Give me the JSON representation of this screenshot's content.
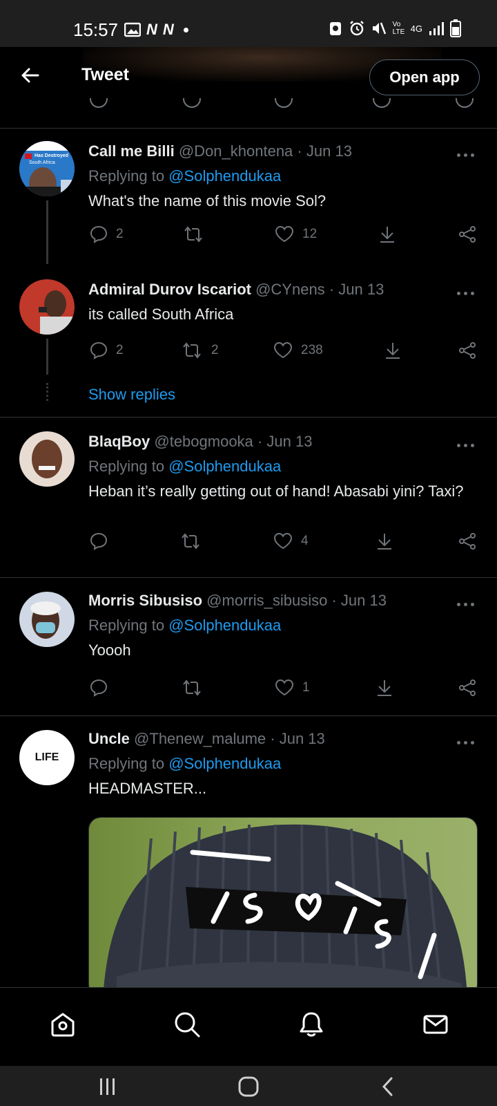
{
  "status_bar": {
    "time": "15:57",
    "network": "4G",
    "volte": "Vo LTE"
  },
  "header": {
    "title": "Tweet",
    "open_app_label": "Open app"
  },
  "tweets": [
    {
      "name": "Call me Billi",
      "handle": "@Don_khontena",
      "date": "Jun 13",
      "replying_label": "Replying to",
      "replying_to": "@Solphendukaa",
      "text": "What's the name of this movie Sol?",
      "replies": "2",
      "retweets": "",
      "likes": "12",
      "avatar_text_top": "Has Destroyed",
      "avatar_text_mid": "South Africa"
    },
    {
      "name": "Admiral Durov Iscariot",
      "handle": "@CYnens",
      "date": "Jun 13",
      "text": "its called South Africa",
      "replies": "2",
      "retweets": "2",
      "likes": "238",
      "show_replies": "Show replies"
    },
    {
      "name": "BlaqBoy",
      "handle": "@tebogmooka",
      "date": "Jun 13",
      "replying_label": "Replying to",
      "replying_to": "@Solphendukaa",
      "text": "Heban it’s really getting out of hand! Abasabi yini? Taxi?",
      "replies": "",
      "retweets": "",
      "likes": "4"
    },
    {
      "name": "Morris Sibusiso",
      "handle": "@morris_sibusiso",
      "date": "Jun 13",
      "replying_label": "Replying to",
      "replying_to": "@Solphendukaa",
      "text": "Yoooh",
      "replies": "",
      "retweets": "",
      "likes": "1"
    },
    {
      "name": "Uncle",
      "handle": "@Thenew_malume",
      "date": "Jun 13",
      "replying_label": "Replying to",
      "replying_to": "@Solphendukaa",
      "text": "HEADMASTER...",
      "avatar_text": "LIFE"
    }
  ],
  "bottom_nav": [
    "home-icon",
    "search-icon",
    "bell-icon",
    "mail-icon"
  ],
  "colors": {
    "background": "#000000",
    "link": "#1d9bf0",
    "muted": "#71767b",
    "divider": "#2f3336"
  }
}
